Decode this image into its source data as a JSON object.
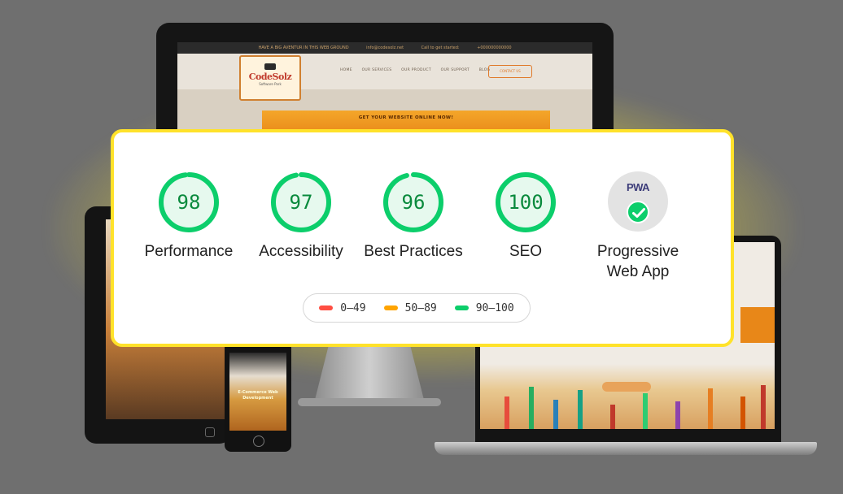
{
  "site_preview": {
    "topbar": [
      "HAVE A BIG AVENTUR IN THIS WEB GROUND",
      "info@codesolz.net",
      "Call to get started:",
      "+000000000000"
    ],
    "nav_links": [
      "HOME",
      "OUR SERVICES",
      "OUR PRODUCT",
      "OUR SUPPORT",
      "BLOG"
    ],
    "nav_cta": "CONTACT US",
    "logo_name": "CodeSolz",
    "logo_tagline": "Software Park",
    "banner_text": "GET YOUR WEBSITE ONLINE NOW!",
    "phone_text": "E-Commerce Web Development"
  },
  "lighthouse": {
    "scores": [
      {
        "value": "98",
        "label": "Performance",
        "fraction": 0.98
      },
      {
        "value": "97",
        "label": "Accessibility",
        "fraction": 0.97
      },
      {
        "value": "96",
        "label": "Best Practices",
        "fraction": 0.96
      },
      {
        "value": "100",
        "label": "SEO",
        "fraction": 1.0
      }
    ],
    "pwa": {
      "logo": "PWA",
      "label_line1": "Progressive",
      "label_line2": "Web App"
    },
    "legend": [
      {
        "range": "0–49",
        "color": "#ff4e42"
      },
      {
        "range": "50–89",
        "color": "#ffa400"
      },
      {
        "range": "90–100",
        "color": "#0cce6b"
      }
    ],
    "colors": {
      "pass_ring": "#0cce6b",
      "pass_fill": "#e6f9ee",
      "pass_text": "#0a8a3d",
      "card_border": "#ffe22a"
    }
  }
}
